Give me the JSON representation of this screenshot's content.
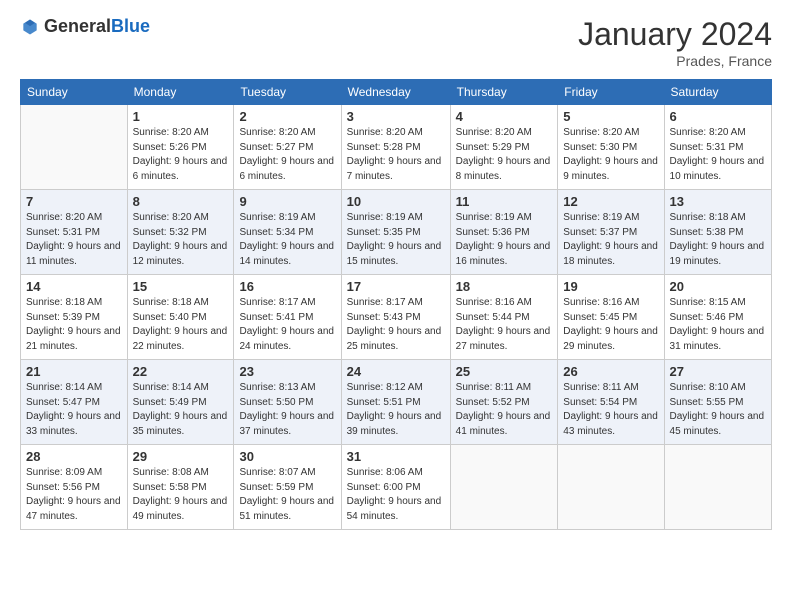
{
  "logo": {
    "general": "General",
    "blue": "Blue"
  },
  "header": {
    "month_title": "January 2024",
    "location": "Prades, France"
  },
  "weekdays": [
    "Sunday",
    "Monday",
    "Tuesday",
    "Wednesday",
    "Thursday",
    "Friday",
    "Saturday"
  ],
  "weeks": [
    [
      {
        "day": "",
        "sunrise": "",
        "sunset": "",
        "daylight": ""
      },
      {
        "day": "1",
        "sunrise": "Sunrise: 8:20 AM",
        "sunset": "Sunset: 5:26 PM",
        "daylight": "Daylight: 9 hours and 6 minutes."
      },
      {
        "day": "2",
        "sunrise": "Sunrise: 8:20 AM",
        "sunset": "Sunset: 5:27 PM",
        "daylight": "Daylight: 9 hours and 6 minutes."
      },
      {
        "day": "3",
        "sunrise": "Sunrise: 8:20 AM",
        "sunset": "Sunset: 5:28 PM",
        "daylight": "Daylight: 9 hours and 7 minutes."
      },
      {
        "day": "4",
        "sunrise": "Sunrise: 8:20 AM",
        "sunset": "Sunset: 5:29 PM",
        "daylight": "Daylight: 9 hours and 8 minutes."
      },
      {
        "day": "5",
        "sunrise": "Sunrise: 8:20 AM",
        "sunset": "Sunset: 5:30 PM",
        "daylight": "Daylight: 9 hours and 9 minutes."
      },
      {
        "day": "6",
        "sunrise": "Sunrise: 8:20 AM",
        "sunset": "Sunset: 5:31 PM",
        "daylight": "Daylight: 9 hours and 10 minutes."
      }
    ],
    [
      {
        "day": "7",
        "sunrise": "Sunrise: 8:20 AM",
        "sunset": "Sunset: 5:31 PM",
        "daylight": "Daylight: 9 hours and 11 minutes."
      },
      {
        "day": "8",
        "sunrise": "Sunrise: 8:20 AM",
        "sunset": "Sunset: 5:32 PM",
        "daylight": "Daylight: 9 hours and 12 minutes."
      },
      {
        "day": "9",
        "sunrise": "Sunrise: 8:19 AM",
        "sunset": "Sunset: 5:34 PM",
        "daylight": "Daylight: 9 hours and 14 minutes."
      },
      {
        "day": "10",
        "sunrise": "Sunrise: 8:19 AM",
        "sunset": "Sunset: 5:35 PM",
        "daylight": "Daylight: 9 hours and 15 minutes."
      },
      {
        "day": "11",
        "sunrise": "Sunrise: 8:19 AM",
        "sunset": "Sunset: 5:36 PM",
        "daylight": "Daylight: 9 hours and 16 minutes."
      },
      {
        "day": "12",
        "sunrise": "Sunrise: 8:19 AM",
        "sunset": "Sunset: 5:37 PM",
        "daylight": "Daylight: 9 hours and 18 minutes."
      },
      {
        "day": "13",
        "sunrise": "Sunrise: 8:18 AM",
        "sunset": "Sunset: 5:38 PM",
        "daylight": "Daylight: 9 hours and 19 minutes."
      }
    ],
    [
      {
        "day": "14",
        "sunrise": "Sunrise: 8:18 AM",
        "sunset": "Sunset: 5:39 PM",
        "daylight": "Daylight: 9 hours and 21 minutes."
      },
      {
        "day": "15",
        "sunrise": "Sunrise: 8:18 AM",
        "sunset": "Sunset: 5:40 PM",
        "daylight": "Daylight: 9 hours and 22 minutes."
      },
      {
        "day": "16",
        "sunrise": "Sunrise: 8:17 AM",
        "sunset": "Sunset: 5:41 PM",
        "daylight": "Daylight: 9 hours and 24 minutes."
      },
      {
        "day": "17",
        "sunrise": "Sunrise: 8:17 AM",
        "sunset": "Sunset: 5:43 PM",
        "daylight": "Daylight: 9 hours and 25 minutes."
      },
      {
        "day": "18",
        "sunrise": "Sunrise: 8:16 AM",
        "sunset": "Sunset: 5:44 PM",
        "daylight": "Daylight: 9 hours and 27 minutes."
      },
      {
        "day": "19",
        "sunrise": "Sunrise: 8:16 AM",
        "sunset": "Sunset: 5:45 PM",
        "daylight": "Daylight: 9 hours and 29 minutes."
      },
      {
        "day": "20",
        "sunrise": "Sunrise: 8:15 AM",
        "sunset": "Sunset: 5:46 PM",
        "daylight": "Daylight: 9 hours and 31 minutes."
      }
    ],
    [
      {
        "day": "21",
        "sunrise": "Sunrise: 8:14 AM",
        "sunset": "Sunset: 5:47 PM",
        "daylight": "Daylight: 9 hours and 33 minutes."
      },
      {
        "day": "22",
        "sunrise": "Sunrise: 8:14 AM",
        "sunset": "Sunset: 5:49 PM",
        "daylight": "Daylight: 9 hours and 35 minutes."
      },
      {
        "day": "23",
        "sunrise": "Sunrise: 8:13 AM",
        "sunset": "Sunset: 5:50 PM",
        "daylight": "Daylight: 9 hours and 37 minutes."
      },
      {
        "day": "24",
        "sunrise": "Sunrise: 8:12 AM",
        "sunset": "Sunset: 5:51 PM",
        "daylight": "Daylight: 9 hours and 39 minutes."
      },
      {
        "day": "25",
        "sunrise": "Sunrise: 8:11 AM",
        "sunset": "Sunset: 5:52 PM",
        "daylight": "Daylight: 9 hours and 41 minutes."
      },
      {
        "day": "26",
        "sunrise": "Sunrise: 8:11 AM",
        "sunset": "Sunset: 5:54 PM",
        "daylight": "Daylight: 9 hours and 43 minutes."
      },
      {
        "day": "27",
        "sunrise": "Sunrise: 8:10 AM",
        "sunset": "Sunset: 5:55 PM",
        "daylight": "Daylight: 9 hours and 45 minutes."
      }
    ],
    [
      {
        "day": "28",
        "sunrise": "Sunrise: 8:09 AM",
        "sunset": "Sunset: 5:56 PM",
        "daylight": "Daylight: 9 hours and 47 minutes."
      },
      {
        "day": "29",
        "sunrise": "Sunrise: 8:08 AM",
        "sunset": "Sunset: 5:58 PM",
        "daylight": "Daylight: 9 hours and 49 minutes."
      },
      {
        "day": "30",
        "sunrise": "Sunrise: 8:07 AM",
        "sunset": "Sunset: 5:59 PM",
        "daylight": "Daylight: 9 hours and 51 minutes."
      },
      {
        "day": "31",
        "sunrise": "Sunrise: 8:06 AM",
        "sunset": "Sunset: 6:00 PM",
        "daylight": "Daylight: 9 hours and 54 minutes."
      },
      {
        "day": "",
        "sunrise": "",
        "sunset": "",
        "daylight": ""
      },
      {
        "day": "",
        "sunrise": "",
        "sunset": "",
        "daylight": ""
      },
      {
        "day": "",
        "sunrise": "",
        "sunset": "",
        "daylight": ""
      }
    ]
  ]
}
